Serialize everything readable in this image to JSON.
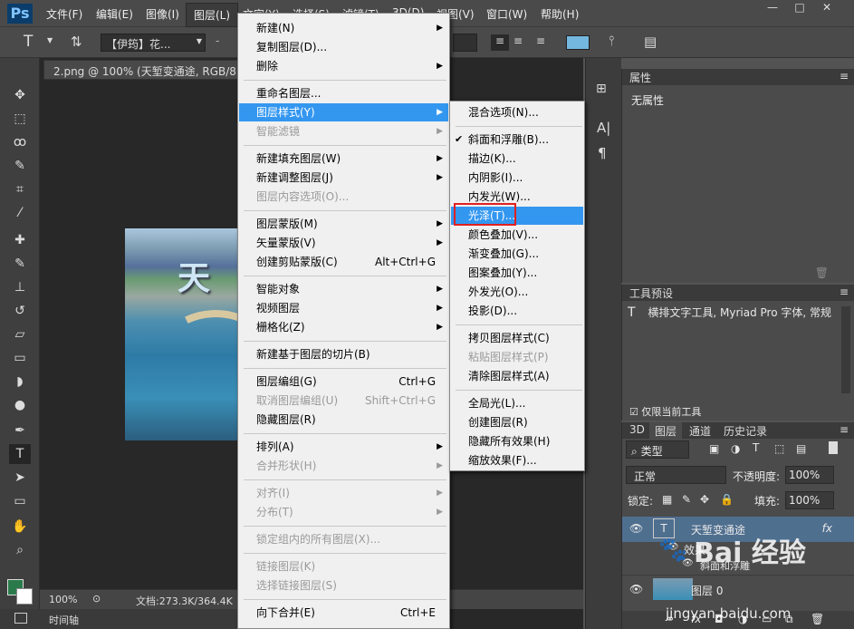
{
  "menubar": {
    "logo": "Ps",
    "items": [
      "文件(F)",
      "编辑(E)",
      "图像(I)",
      "图层(L)",
      "文字(Y)",
      "选择(S)",
      "滤镜(T)",
      "3D(D)",
      "视图(V)",
      "窗口(W)",
      "帮助(H)"
    ],
    "active_index": 3,
    "window_controls": [
      "—",
      "□",
      "✕"
    ]
  },
  "options": {
    "font_family": "【伊筠】花...",
    "size_prefix": "-"
  },
  "document": {
    "tab_title": "2.png @ 100% (天堑变通途, RGB/8) *",
    "zoom": "100%",
    "doc_size": "文档:273.3K/364.4K",
    "timeline": "时间轴"
  },
  "layer_menu": {
    "items": [
      {
        "label": "新建(N)",
        "submenu": true,
        "disabled": false
      },
      {
        "label": "复制图层(D)...",
        "disabled": false
      },
      {
        "label": "删除",
        "submenu": true,
        "disabled": false
      },
      {
        "sep": true
      },
      {
        "label": "重命名图层...",
        "disabled": false
      },
      {
        "label": "图层样式(Y)",
        "submenu": true,
        "highlighted": true
      },
      {
        "label": "智能滤镜",
        "submenu": true,
        "disabled": true
      },
      {
        "sep": true
      },
      {
        "label": "新建填充图层(W)",
        "submenu": true
      },
      {
        "label": "新建调整图层(J)",
        "submenu": true
      },
      {
        "label": "图层内容选项(O)...",
        "disabled": true
      },
      {
        "sep": true
      },
      {
        "label": "图层蒙版(M)",
        "submenu": true
      },
      {
        "label": "矢量蒙版(V)",
        "submenu": true
      },
      {
        "label": "创建剪贴蒙版(C)",
        "shortcut": "Alt+Ctrl+G"
      },
      {
        "sep": true
      },
      {
        "label": "智能对象",
        "submenu": true
      },
      {
        "label": "视频图层",
        "submenu": true
      },
      {
        "label": "栅格化(Z)",
        "submenu": true
      },
      {
        "sep": true
      },
      {
        "label": "新建基于图层的切片(B)"
      },
      {
        "sep": true
      },
      {
        "label": "图层编组(G)",
        "shortcut": "Ctrl+G"
      },
      {
        "label": "取消图层编组(U)",
        "shortcut": "Shift+Ctrl+G",
        "disabled": true
      },
      {
        "label": "隐藏图层(R)"
      },
      {
        "sep": true
      },
      {
        "label": "排列(A)",
        "submenu": true
      },
      {
        "label": "合并形状(H)",
        "submenu": true,
        "disabled": true
      },
      {
        "sep": true
      },
      {
        "label": "对齐(I)",
        "submenu": true,
        "disabled": true
      },
      {
        "label": "分布(T)",
        "submenu": true,
        "disabled": true
      },
      {
        "sep": true
      },
      {
        "label": "锁定组内的所有图层(X)...",
        "disabled": true
      },
      {
        "sep": true
      },
      {
        "label": "链接图层(K)",
        "disabled": true
      },
      {
        "label": "选择链接图层(S)",
        "disabled": true
      },
      {
        "sep": true
      },
      {
        "label": "向下合并(E)",
        "shortcut": "Ctrl+E"
      }
    ]
  },
  "style_submenu": {
    "items": [
      {
        "label": "混合选项(N)..."
      },
      {
        "sep": true
      },
      {
        "label": "斜面和浮雕(B)...",
        "checked": true
      },
      {
        "label": "描边(K)..."
      },
      {
        "label": "内阴影(I)..."
      },
      {
        "label": "内发光(W)..."
      },
      {
        "label": "光泽(T)...",
        "highlighted": true
      },
      {
        "label": "颜色叠加(V)..."
      },
      {
        "label": "渐变叠加(G)..."
      },
      {
        "label": "图案叠加(Y)..."
      },
      {
        "label": "外发光(O)..."
      },
      {
        "label": "投影(D)..."
      },
      {
        "sep": true
      },
      {
        "label": "拷贝图层样式(C)"
      },
      {
        "label": "粘贴图层样式(P)",
        "disabled": true
      },
      {
        "label": "清除图层样式(A)"
      },
      {
        "sep": true
      },
      {
        "label": "全局光(L)..."
      },
      {
        "label": "创建图层(R)"
      },
      {
        "label": "隐藏所有效果(H)"
      },
      {
        "label": "缩放效果(F)..."
      }
    ]
  },
  "properties": {
    "title": "属性",
    "content": "无属性"
  },
  "tool_presets": {
    "title": "工具预设",
    "item": "横排文字工具, Myriad Pro 字体, 常规",
    "current_only": "仅限当前工具"
  },
  "layers": {
    "tabs": [
      "3D",
      "图层",
      "通道",
      "历史记录"
    ],
    "active_tab": 1,
    "filter_label": "类型",
    "blend_mode": "正常",
    "opacity_label": "不透明度:",
    "opacity_value": "100%",
    "lock_label": "锁定:",
    "fill_label": "填充:",
    "fill_value": "100%",
    "rows": [
      {
        "name": "天堑变通途",
        "type": "T",
        "fx": "fx"
      },
      {
        "name": "效果"
      },
      {
        "name": "斜面和浮雕"
      },
      {
        "name": "图层 0"
      }
    ]
  },
  "watermark": {
    "brand": "Bai 经验",
    "url": "jingyan.baidu.com"
  },
  "colors": {
    "highlight": "#3397f0",
    "redbox": "#e02020",
    "foreground": "#2b7a4b",
    "background": "#ffffff"
  }
}
